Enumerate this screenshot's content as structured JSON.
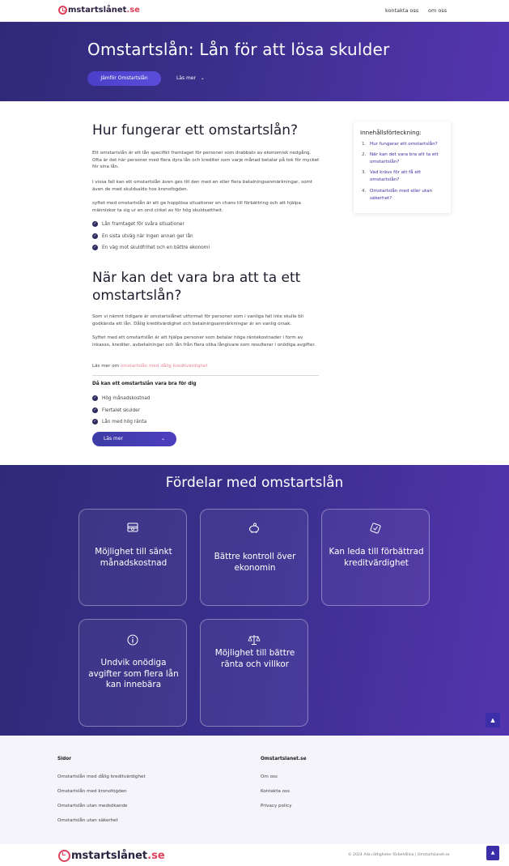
{
  "header": {
    "logo_main": "mstartslånet",
    "logo_tld": ".se",
    "nav": [
      "kontakta oss",
      "om oss"
    ]
  },
  "hero": {
    "title": "Omstartslån: Lån för att lösa skulder",
    "button_label": "Jämför Omstartslån",
    "more_label": "Läs mer"
  },
  "section1": {
    "heading": "Hur fungerar ett omstartslån?",
    "paragraphs": [
      "Ett omstartslån är ett lån specifikt framtaget för personer som drabbats av ekonomisk nedgång. Ofta är det här personer med flera dyra lån och krediter som varje månad betalar på tok för mycket för sina lån.",
      "I vissa fall kan ett omstartslån även ges till den med en eller flera betalningsanmärkningar, somt även de med skuldsaldo hos kronofogden.",
      "syftet med omstartslån är att ge hopplösa situationer en chans till förbättring och att hjälpa människor ta sig ur en ond cirkel av för hög skuldsattheit."
    ],
    "checklist": [
      "Lån framtaget för svåra situationer",
      "En sista utväg när ingen annan ger lån",
      "En väg mot skuldfrihet och en bättre ekonomi"
    ]
  },
  "section2": {
    "heading_line1": "När kan det vara bra att ta ett",
    "heading_line2": "omstartslån?",
    "paragraphs": [
      "Som vi nämnt tidigare är omstartslånet utformat för personer som i vanliga fall inte skulle bli godkända ett lån. Dålig kreditvärdighet och betalningsanmärkningar är en vanlig orsak.",
      "Syftet med ett omstartslån är att hjälpa personer som betalar höga räntekostnader i form av inkasso, krediter, avbetalningar och lån från flera olika långivare som resulterar i onödiga avgifter."
    ],
    "read_more_prefix": "Läs mer om",
    "read_more_link": "omstartslån med dålig kreditvärdighet",
    "subheading": "Då kan ett omstartslån vara bra för dig",
    "checklist": [
      "Hög månadskostnad",
      "Flertalet skulder",
      "Lån med hög ränta"
    ],
    "button_label": "Läs mer"
  },
  "toc": {
    "title": "Innehållsförteckning:",
    "items": [
      {
        "num": "1.",
        "label": "Hur fungerar ett omstartslån?"
      },
      {
        "num": "2.",
        "label": "När kan det vara bra att ta ett omstartslån?"
      },
      {
        "num": "3.",
        "label": "Vad krävs för att få ett omstartslån?"
      },
      {
        "num": "4.",
        "label": "Omstartslån med eller utan säkerhet?"
      }
    ]
  },
  "features": {
    "title": "Fördelar med omstartslån",
    "cards": [
      {
        "icon": "money-stack-icon",
        "label": "Möjlighet till sänkt månadskostnad"
      },
      {
        "icon": "piggy-bank-icon",
        "label": "Bättre kontroll över ekonomin"
      },
      {
        "icon": "credit-check-icon",
        "label": "Kan leda till förbättrad kreditvärdighet"
      },
      {
        "icon": "info-circle-icon",
        "label": "Undvik onödiga avgifter som flera lån kan innebära"
      },
      {
        "icon": "scale-icon",
        "label": "Möjlighet till bättre ränta och villkor"
      }
    ]
  },
  "footer": {
    "col1_title": "Sidor",
    "col1_links": [
      "Omstartslån med dålig kreditvärdighet",
      "Omstartslån med kronofogden",
      "Omstartslån utan medsökande",
      "Omstartslån utan säkerhet"
    ],
    "col2_title": "Omstartslanet.se",
    "col2_links": [
      "Om oss",
      "Kontakta oss",
      "Privacy policy"
    ],
    "copyright": "© 2024 Alla rättigheter förbehållna | Omstartslanet.se"
  },
  "colors": {
    "brand_purple": "#3b2f8c",
    "accent_pink": "#e0425c",
    "link_purple": "#3b2fa0"
  }
}
